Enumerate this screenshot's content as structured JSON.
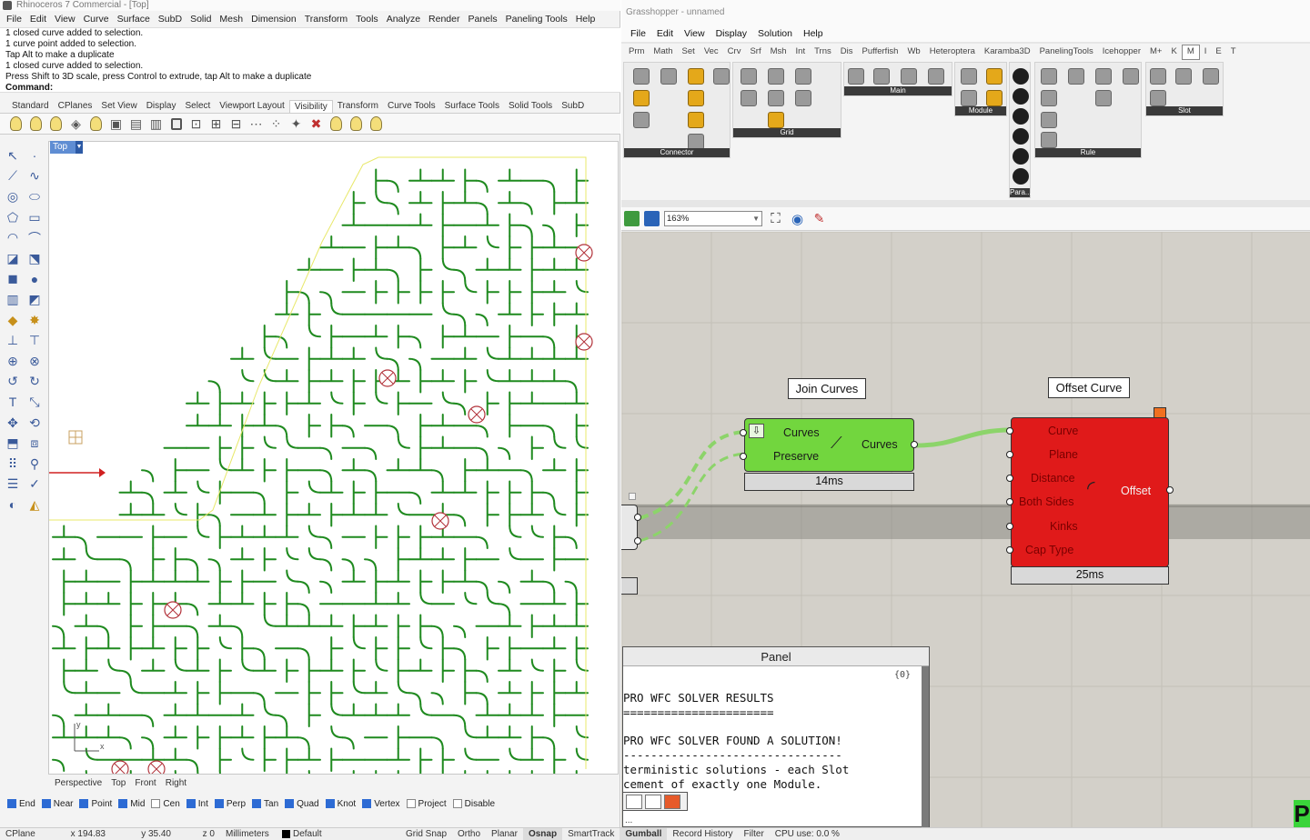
{
  "rhino": {
    "title": "Rhinoceros 7 Commercial - [Top]",
    "menu": [
      "File",
      "Edit",
      "View",
      "Curve",
      "Surface",
      "SubD",
      "Solid",
      "Mesh",
      "Dimension",
      "Transform",
      "Tools",
      "Analyze",
      "Render",
      "Panels",
      "Paneling Tools",
      "Help"
    ],
    "command_history": [
      "1 closed curve added to selection.",
      "1 curve point added to selection.",
      "Tap Alt to make a duplicate",
      "1 closed curve added to selection.",
      "Press Shift to 3D scale, press Control to extrude, tap Alt to make a duplicate"
    ],
    "command_prompt": "Command:",
    "toolbar_tabs": [
      "Standard",
      "CPlanes",
      "Set View",
      "Display",
      "Select",
      "Viewport Layout",
      "Visibility",
      "Transform",
      "Curve Tools",
      "Surface Tools",
      "Solid Tools",
      "SubD"
    ],
    "active_toolbar_tab": "Visibility",
    "viewport_name": "Top",
    "viewport_tabs": [
      "Perspective",
      "Top",
      "Front",
      "Right"
    ],
    "axis_labels": {
      "x": "x",
      "y": "y"
    },
    "osnaps": [
      {
        "label": "End",
        "checked": true
      },
      {
        "label": "Near",
        "checked": true
      },
      {
        "label": "Point",
        "checked": true
      },
      {
        "label": "Mid",
        "checked": true
      },
      {
        "label": "Cen",
        "checked": false
      },
      {
        "label": "Int",
        "checked": true
      },
      {
        "label": "Perp",
        "checked": true
      },
      {
        "label": "Tan",
        "checked": true
      },
      {
        "label": "Quad",
        "checked": true
      },
      {
        "label": "Knot",
        "checked": true
      },
      {
        "label": "Vertex",
        "checked": true
      },
      {
        "label": "Project",
        "checked": false
      },
      {
        "label": "Disable",
        "checked": false
      }
    ],
    "status": {
      "cplane": "CPlane",
      "x": "x 194.83",
      "y": "y 35.40",
      "z": "z 0",
      "units": "Millimeters",
      "layer": "Default",
      "toggles": [
        "Grid Snap",
        "Ortho",
        "Planar",
        "Osnap",
        "SmartTrack",
        "Gumball",
        "Record History",
        "Filter"
      ],
      "bold_toggles": [
        "Osnap",
        "Gumball"
      ],
      "cpu": "CPU use: 0.0 %"
    },
    "colors": {
      "curve": "#1f8a1f",
      "outline": "#e8e86a",
      "selection_mark": "#b2323a"
    }
  },
  "grasshopper": {
    "title": "Grasshopper - unnamed",
    "menu": [
      "File",
      "Edit",
      "View",
      "Display",
      "Solution",
      "Help"
    ],
    "categories": [
      "Prm",
      "Math",
      "Set",
      "Vec",
      "Crv",
      "Srf",
      "Msh",
      "Int",
      "Trns",
      "Dis",
      "Pufferfish",
      "Wb",
      "Heteroptera",
      "Karamba3D",
      "PanelingTools",
      "Icehopper",
      "M+",
      "K",
      "M",
      "I",
      "E",
      "T"
    ],
    "active_category": "M",
    "ribbon_groups": [
      "Connector",
      "Grid",
      "Main",
      "Module",
      "Para...",
      "Rule",
      "Slot"
    ],
    "zoom": "163%",
    "components": {
      "join_curves": {
        "title": "Join Curves",
        "inputs": [
          "Curves",
          "Preserve"
        ],
        "output": "Curves",
        "timing": "14ms",
        "color": "#72d63e"
      },
      "offset_curve": {
        "title": "Offset Curve",
        "inputs": [
          "Curve",
          "Plane",
          "Distance",
          "Both Sides",
          "Kinks",
          "Cap Type"
        ],
        "output": "Offset",
        "timing": "25ms",
        "color": "#e01a1a"
      }
    },
    "panel": {
      "title": "Panel",
      "count": "{0}",
      "lines": [
        "PRO WFC SOLVER RESULTS",
        "======================",
        "",
        "PRO WFC SOLVER FOUND A SOLUTION!",
        "--------------------------------",
        "terministic solutions - each Slot",
        "cement of exactly one Module."
      ]
    },
    "status_extra": "..."
  }
}
